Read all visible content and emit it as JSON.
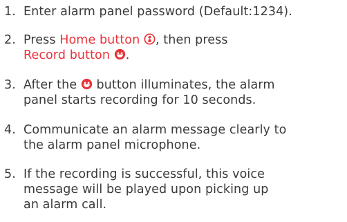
{
  "steps": [
    {
      "number": "1.",
      "text": "Enter alarm panel password (Default:1234)."
    },
    {
      "number": "2.",
      "press1": "Press ",
      "home_button": "Home button",
      "then_press": ", then press",
      "record_button": "Record button",
      "end": "."
    },
    {
      "number": "3.",
      "after_the": "After the ",
      "button_illuminates": " button illuminates, the alarm",
      "line2": "panel starts recording for 10 seconds."
    },
    {
      "number": "4.",
      "line1": "Communicate an alarm message clearly to",
      "line2": "the alarm panel microphone."
    },
    {
      "number": "5.",
      "line1": "If the recording is successful, this voice",
      "line2": "message will be played upon picking up",
      "line3": "an alarm call."
    }
  ],
  "icons": {
    "home": "home-icon",
    "record": "record-icon",
    "accent_color": "#e8333b"
  }
}
